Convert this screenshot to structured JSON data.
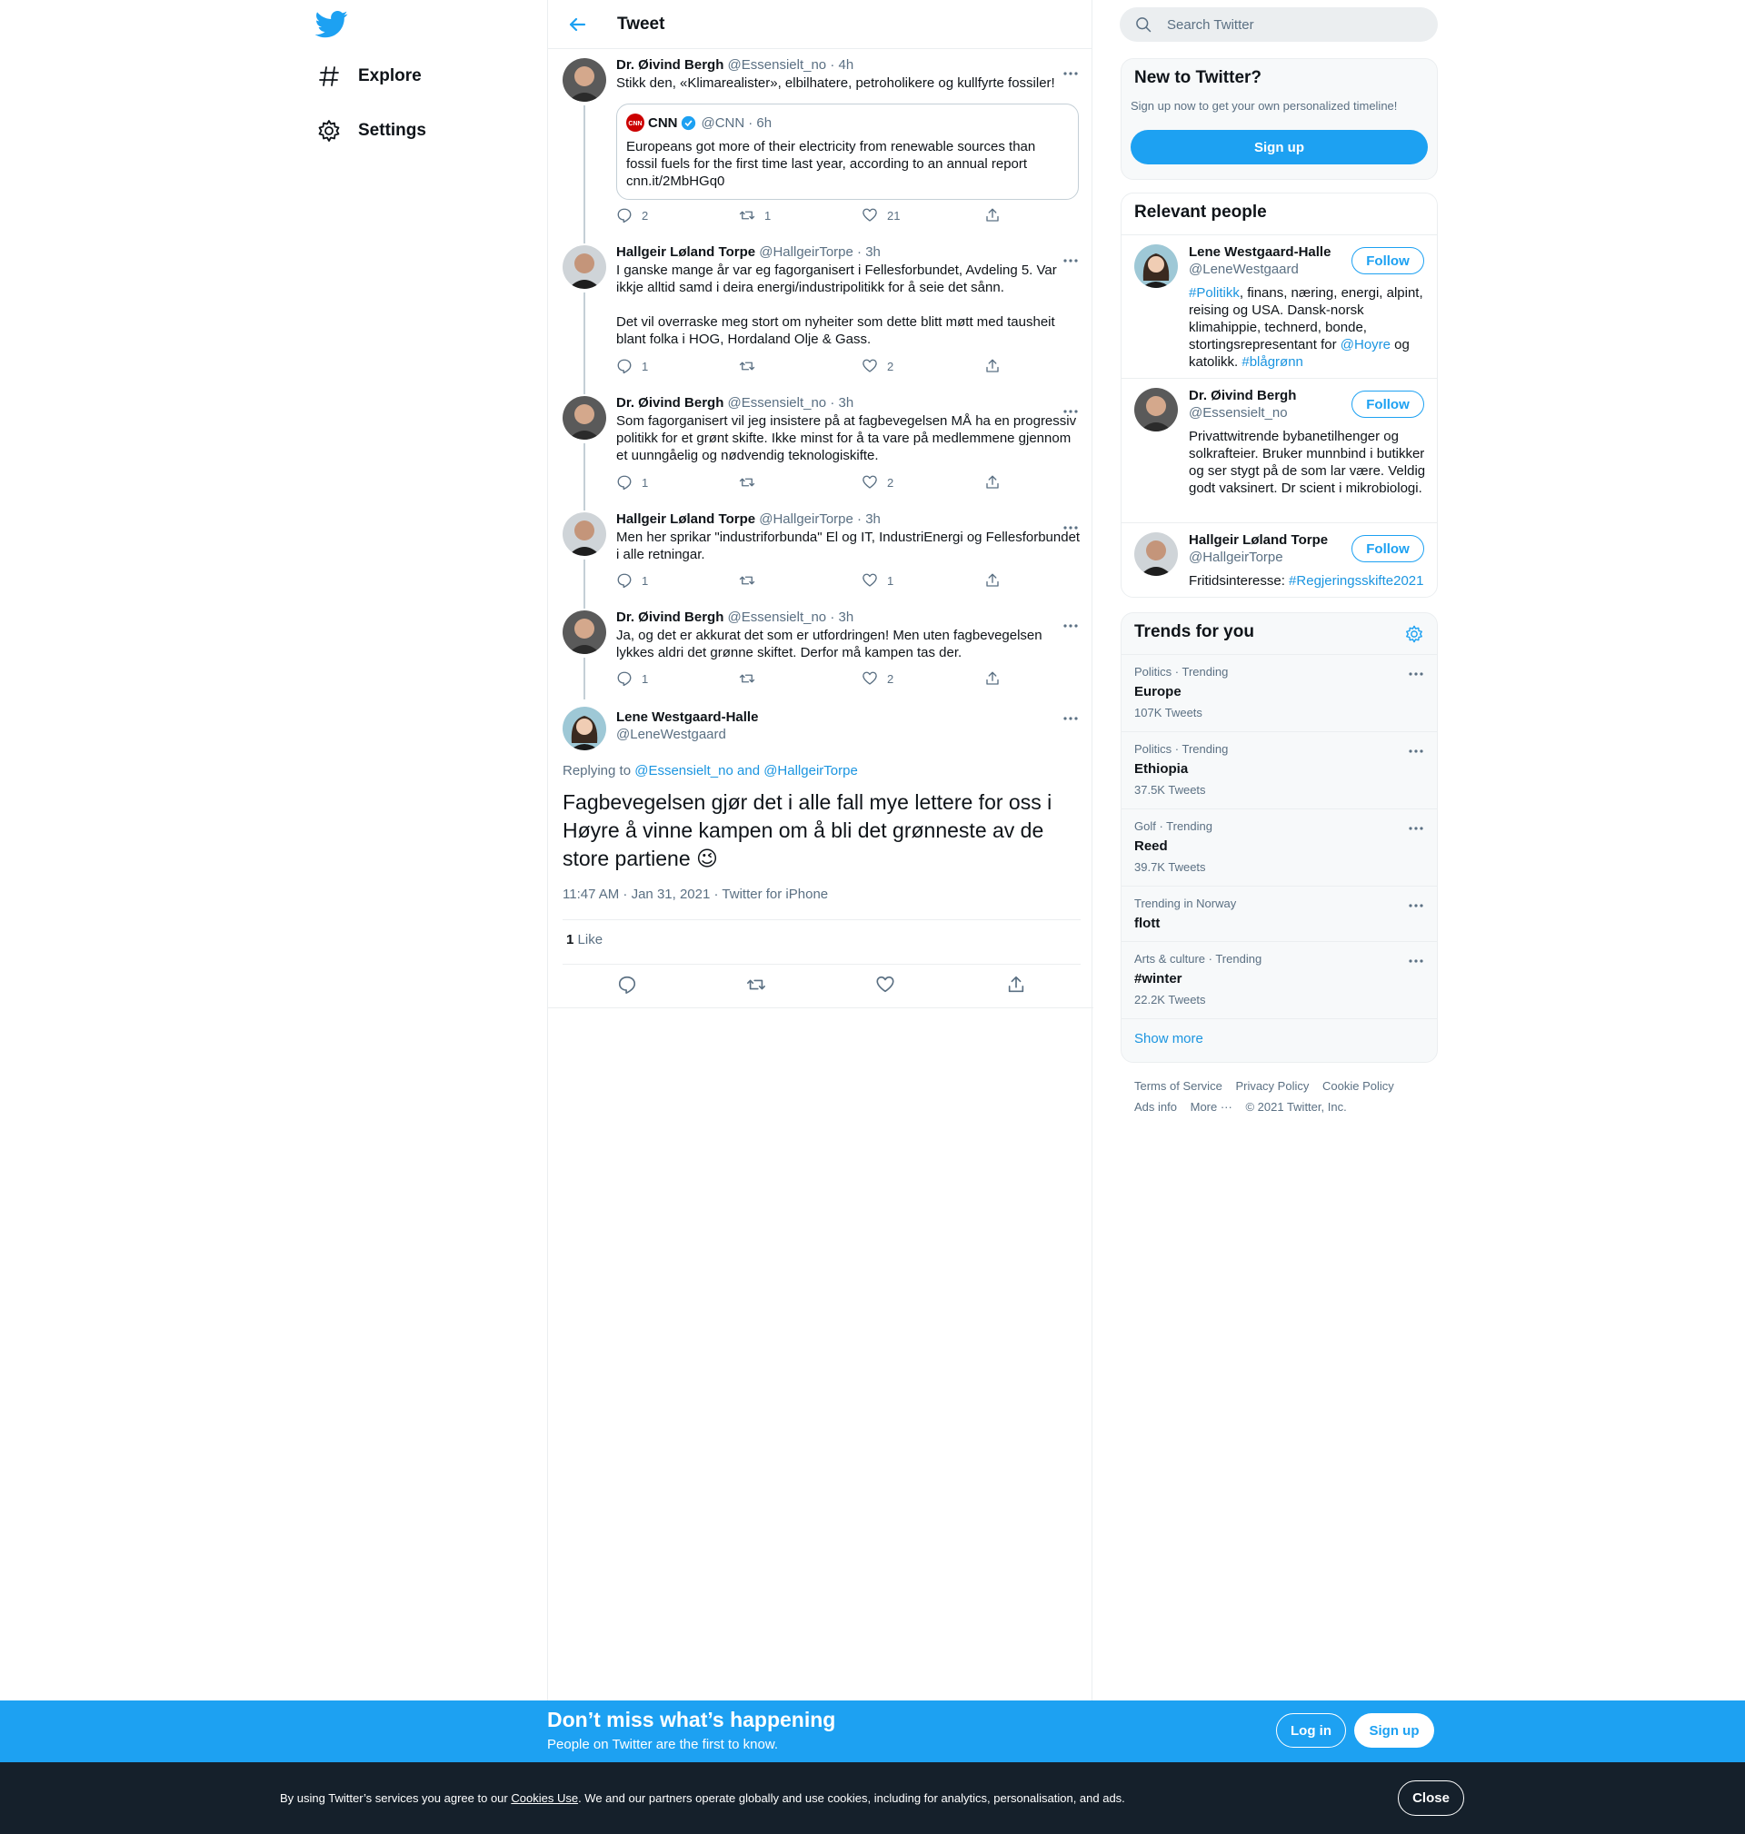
{
  "nav": {
    "explore_label": "Explore",
    "settings_label": "Settings"
  },
  "header": {
    "title": "Tweet"
  },
  "thread": [
    {
      "name": "Dr. Øivind Bergh",
      "handle": "@Essensielt_no",
      "time": "· 4h",
      "text": "Stikk den, «Klimarealister», elbilhatere, petroholikere og kullfyrte fossiler!",
      "replies": "2",
      "retweets": "1",
      "likes": "21"
    },
    {
      "name": "Hallgeir Løland Torpe",
      "handle": "@HallgeirTorpe",
      "time": "· 3h",
      "text_p1": "I ganske mange år var eg fagorganisert i Fellesforbundet, Avdeling 5. Var ikkje alltid samd i deira energi/industripolitikk for å seie det sånn.",
      "text_p2": "Det vil overraske meg stort om nyheiter som dette blitt møtt med tausheit blant folka i HOG, Hordaland Olje & Gass.",
      "replies": "1",
      "retweets": "",
      "likes": "2"
    },
    {
      "name": "Dr. Øivind Bergh",
      "handle": "@Essensielt_no",
      "time": "· 3h",
      "text": "Som fagorganisert vil jeg insistere på at fagbevegelsen MÅ ha en progressiv politikk for et grønt skifte. Ikke minst for å ta vare på medlemmene gjennom et uunngåelig og nødvendig teknologiskifte.",
      "replies": "1",
      "retweets": "",
      "likes": "2"
    },
    {
      "name": "Hallgeir Løland Torpe",
      "handle": "@HallgeirTorpe",
      "time": "· 3h",
      "text": "Men her sprikar \"industriforbunda\" El og IT, IndustriEnergi og Fellesforbundet i alle retningar.",
      "replies": "1",
      "retweets": "",
      "likes": "1"
    },
    {
      "name": "Dr. Øivind Bergh",
      "handle": "@Essensielt_no",
      "time": "· 3h",
      "text": "Ja, og det er akkurat det som er utfordringen! Men uten fagbevegelsen lykkes aldri det grønne skiftet. Derfor må kampen tas der.",
      "replies": "1",
      "retweets": "",
      "likes": "2"
    }
  ],
  "quote": {
    "name": "CNN",
    "handle": "@CNN",
    "time": "· 6h",
    "text": "Europeans got more of their electricity from renewable sources than fossil fuels for the first time last year, according to an annual report cnn.it/2MbHGq0"
  },
  "main_tweet": {
    "name": "Lene Westgaard-Halle",
    "handle": "@LeneWestgaard",
    "replying_prefix": "Replying to",
    "replying_to": "@Essensielt_no and @HallgeirTorpe",
    "text": "Fagbevegelsen gjør det i alle fall mye lettere for oss i Høyre å vinne kampen om å bli det grønneste av de store partiene",
    "emoji": "😉",
    "timestamp": "11:47 AM · Jan 31, 2021",
    "source": "· Twitter for iPhone",
    "likes_count": "1",
    "likes_label": "Like"
  },
  "search": {
    "placeholder": "Search Twitter"
  },
  "signup_panel": {
    "title": "New to Twitter?",
    "subtitle": "Sign up now to get your own personalized timeline!",
    "button": "Sign up"
  },
  "relevant": {
    "title": "Relevant people",
    "follow_label": "Follow",
    "people": [
      {
        "name": "Lene Westgaard-Halle",
        "handle": "@LeneWestgaard",
        "bio_tag1": "#Politikk",
        "bio_a": ", finans, næring, energi, alpint, reising og USA. Dansk-norsk klimahippie, technerd, bonde, stortingsrepresentant for ",
        "bio_mention": "@Hoyre",
        "bio_b": " og katolikk. ",
        "bio_tag2": "#blågrønn"
      },
      {
        "name": "Dr. Øivind Bergh",
        "handle": "@Essensielt_no",
        "bio": "Privattwitrende bybanetilhenger og solkrafteier. Bruker munnbind i butikker og ser stygt på de som lar være. Veldig godt vaksinert. Dr scient i mikrobiologi."
      },
      {
        "name": "Hallgeir Løland Torpe",
        "handle": "@HallgeirTorpe",
        "bio_a": "Fritidsinteresse: ",
        "bio_tag": "#Regjeringsskifte2021"
      }
    ]
  },
  "trends": {
    "title": "Trends for you",
    "items": [
      {
        "category": "Politics · Trending",
        "name": "Europe",
        "count": "107K Tweets"
      },
      {
        "category": "Politics · Trending",
        "name": "Ethiopia",
        "count": "37.5K Tweets"
      },
      {
        "category": "Golf · Trending",
        "name": "Reed",
        "count": "39.7K Tweets"
      },
      {
        "category": "Trending in Norway",
        "name": "flott",
        "count": ""
      },
      {
        "category": "Arts & culture · Trending",
        "name": "#winter",
        "count": "22.2K Tweets"
      }
    ],
    "show_more": "Show more"
  },
  "footer": {
    "terms": "Terms of Service",
    "privacy": "Privacy Policy",
    "cookie": "Cookie Policy",
    "ads": "Ads info",
    "more": "More ···",
    "copyright": "© 2021 Twitter, Inc."
  },
  "bottom_bar": {
    "title": "Don’t miss what’s happening",
    "subtitle": "People on Twitter are the first to know.",
    "login": "Log in",
    "signup": "Sign up"
  },
  "cookie_bar": {
    "text_a": "By using Twitter’s services you agree to our ",
    "link": "Cookies Use",
    "text_b": ". We and our partners operate globally and use cookies, including for analytics, personalisation, and ads.",
    "close": "Close"
  },
  "colors": {
    "accent": "#1da1f2",
    "link": "#1b95e0",
    "muted": "#5b7083",
    "cookie_bg": "#15202b"
  }
}
